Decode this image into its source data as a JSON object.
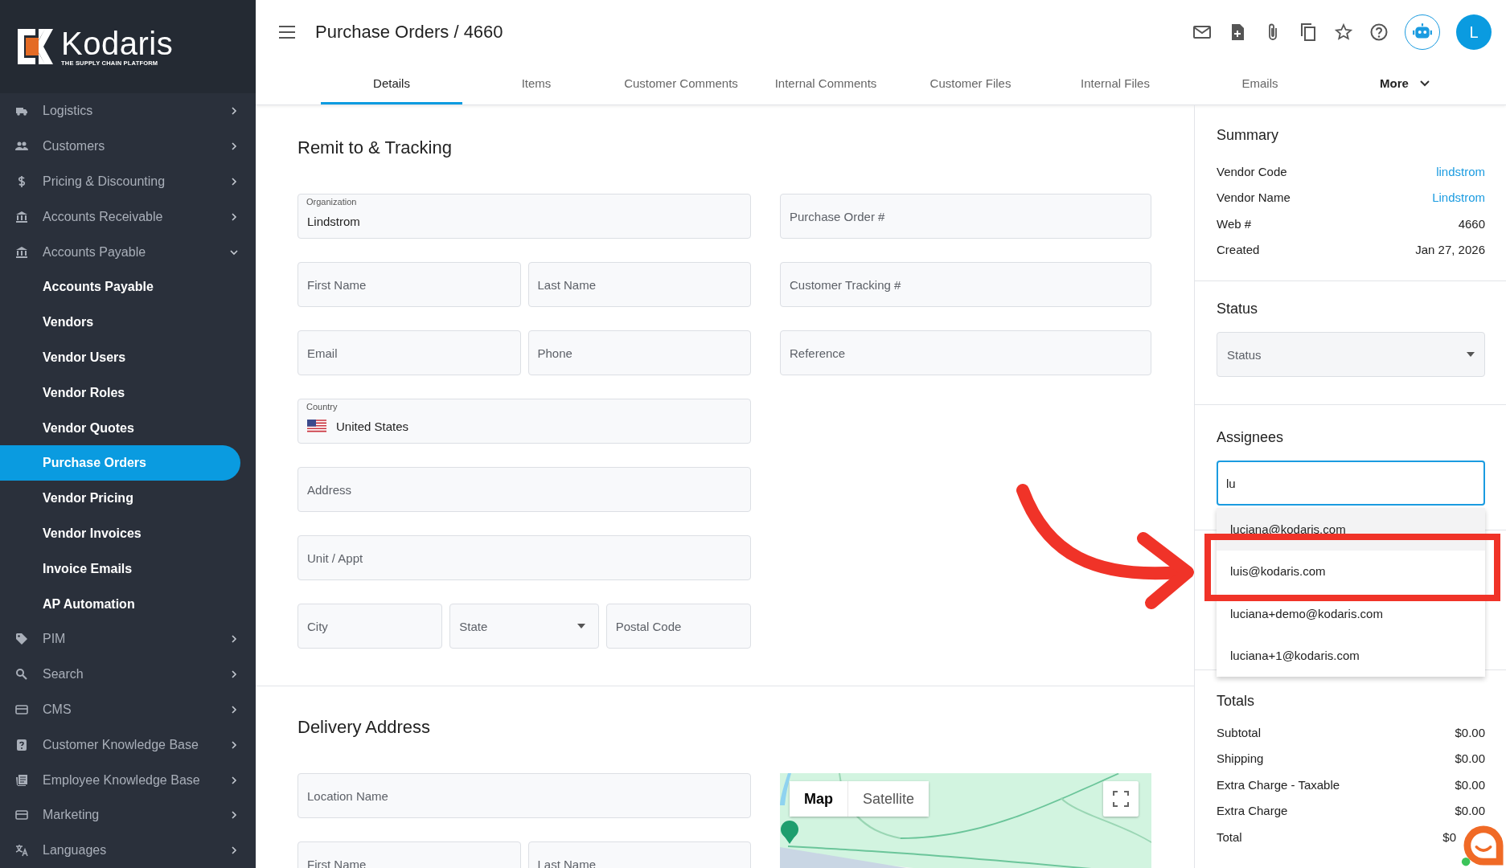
{
  "sidebar": {
    "logo": {
      "name": "Kodaris",
      "tagline": "THE SUPPLY CHAIN PLATFORM"
    },
    "items": [
      {
        "label": "Logistics",
        "expanded": false
      },
      {
        "label": "Customers",
        "expanded": false
      },
      {
        "label": "Pricing & Discounting",
        "expanded": false
      },
      {
        "label": "Accounts Receivable",
        "expanded": false
      },
      {
        "label": "Accounts Payable",
        "expanded": true,
        "children": [
          {
            "label": "Accounts Payable",
            "selected": false
          },
          {
            "label": "Vendors",
            "selected": false
          },
          {
            "label": "Vendor Users",
            "selected": false
          },
          {
            "label": "Vendor Roles",
            "selected": false
          },
          {
            "label": "Vendor Quotes",
            "selected": false
          },
          {
            "label": "Purchase Orders",
            "selected": true
          },
          {
            "label": "Vendor Pricing",
            "selected": false
          },
          {
            "label": "Vendor Invoices",
            "selected": false
          },
          {
            "label": "Invoice Emails",
            "selected": false
          },
          {
            "label": "AP Automation",
            "selected": false
          }
        ]
      },
      {
        "label": "PIM",
        "expanded": false
      },
      {
        "label": "Search",
        "expanded": false
      },
      {
        "label": "CMS",
        "expanded": false
      },
      {
        "label": "Customer Knowledge Base",
        "expanded": false
      },
      {
        "label": "Employee Knowledge Base",
        "expanded": false
      },
      {
        "label": "Marketing",
        "expanded": false
      },
      {
        "label": "Languages",
        "expanded": false
      }
    ]
  },
  "header": {
    "title": "Purchase Orders / 4660",
    "avatar": "L"
  },
  "tabs": [
    {
      "label": "Details",
      "selected": true,
      "kind": "tab"
    },
    {
      "label": "Items",
      "selected": false,
      "kind": "tab"
    },
    {
      "label": "Customer Comments",
      "selected": false,
      "kind": "tab"
    },
    {
      "label": "Internal Comments",
      "selected": false,
      "kind": "tab"
    },
    {
      "label": "Customer Files",
      "selected": false,
      "kind": "tab"
    },
    {
      "label": "Internal Files",
      "selected": false,
      "kind": "tab"
    },
    {
      "label": "Emails",
      "selected": false,
      "kind": "tab"
    },
    {
      "label": "More",
      "selected": false,
      "kind": "menu"
    }
  ],
  "remit": {
    "title": "Remit to & Tracking",
    "left_rows": [
      [
        {
          "kind": "floating",
          "label": "Organization",
          "value": "Lindstrom"
        }
      ],
      [
        {
          "kind": "text",
          "placeholder": "First Name"
        },
        {
          "kind": "text",
          "placeholder": "Last Name"
        }
      ],
      [
        {
          "kind": "text",
          "placeholder": "Email"
        },
        {
          "kind": "text",
          "placeholder": "Phone"
        }
      ],
      [
        {
          "kind": "country",
          "label": "Country",
          "value": "United States"
        }
      ],
      [
        {
          "kind": "text",
          "placeholder": "Address"
        }
      ],
      [
        {
          "kind": "text",
          "placeholder": "Unit / Appt"
        }
      ],
      [
        {
          "kind": "text",
          "placeholder": "City"
        },
        {
          "kind": "select",
          "placeholder": "State"
        },
        {
          "kind": "text",
          "placeholder": "Postal Code"
        }
      ]
    ],
    "right_fields": [
      {
        "placeholder": "Purchase Order #"
      },
      {
        "placeholder": "Customer Tracking #"
      },
      {
        "placeholder": "Reference"
      }
    ]
  },
  "delivery": {
    "title": "Delivery Address",
    "left_rows": [
      [
        {
          "kind": "text",
          "placeholder": "Location Name"
        }
      ],
      [
        {
          "kind": "text",
          "placeholder": "First Name"
        },
        {
          "kind": "text",
          "placeholder": "Last Name"
        }
      ]
    ],
    "map": {
      "kind": "picture",
      "types": [
        {
          "label": "Map",
          "selected": true
        },
        {
          "label": "Satellite",
          "selected": false
        }
      ]
    }
  },
  "summary": {
    "title": "Summary",
    "rows": [
      {
        "label": "Vendor Code",
        "value": "lindstrom",
        "link": true
      },
      {
        "label": "Vendor Name",
        "value": "Lindstrom",
        "link": true
      },
      {
        "label": "Web #",
        "value": "4660",
        "link": false
      },
      {
        "label": "Created",
        "value": "Jan 27, 2026",
        "link": false
      }
    ]
  },
  "status": {
    "title": "Status",
    "select": {
      "placeholder": "Status"
    }
  },
  "assignees": {
    "title": "Assignees",
    "input": {
      "value": "lu"
    },
    "options": [
      {
        "label": "luciana@kodaris.com",
        "highlighted": true
      },
      {
        "label": "luis@kodaris.com",
        "highlighted": false
      },
      {
        "label": "luciana+demo@kodaris.com",
        "highlighted": false
      },
      {
        "label": "luciana+1@kodaris.com",
        "highlighted": false
      }
    ]
  },
  "totals": {
    "title": "Totals",
    "rows": [
      {
        "label": "Subtotal",
        "value": "$0.00"
      },
      {
        "label": "Shipping",
        "value": "$0.00"
      },
      {
        "label": "Extra Charge - Taxable",
        "value": "$0.00"
      },
      {
        "label": "Extra Charge",
        "value": "$0.00"
      },
      {
        "label": "Total",
        "value": "$0"
      }
    ]
  }
}
